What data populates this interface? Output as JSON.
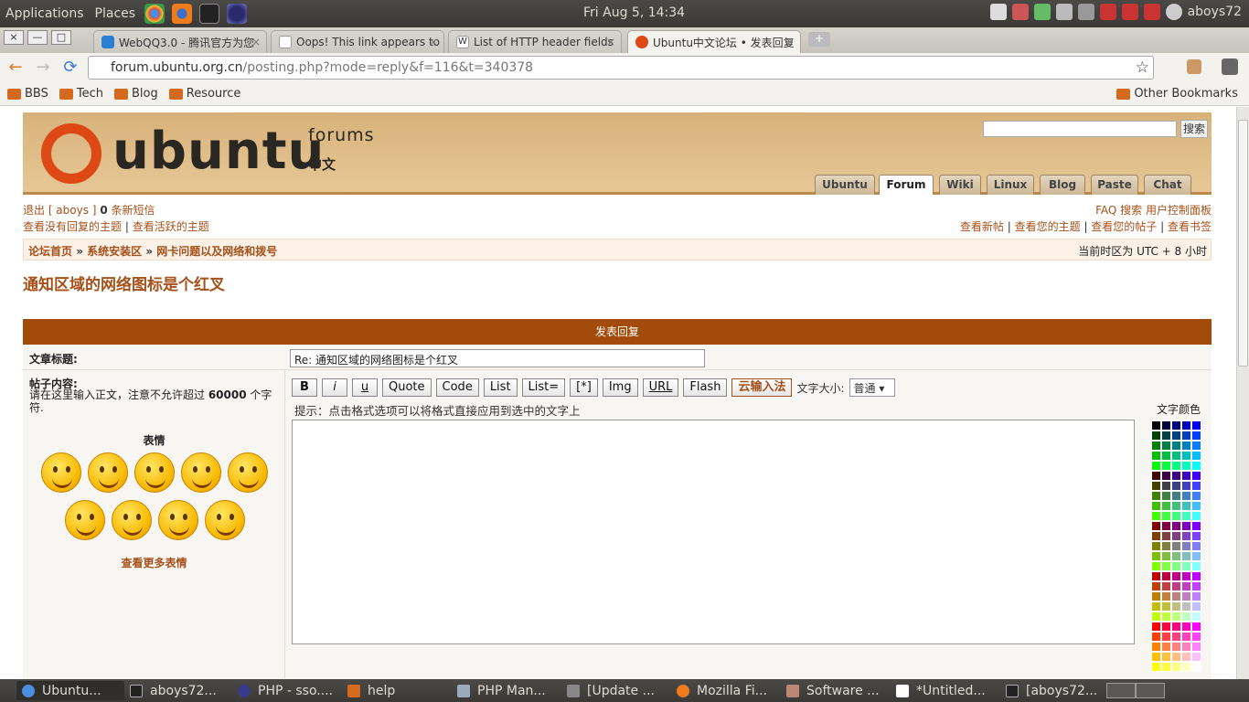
{
  "top_panel": {
    "applications": "Applications",
    "places": "Places",
    "clock": "Fri Aug  5, 14:34",
    "user": "aboys72"
  },
  "tabs": [
    {
      "label": "WebQQ3.0 - 腾讯官方为您",
      "color": "#2a7fd4"
    },
    {
      "label": "Oops! This link appears to",
      "color": "#ffffff"
    },
    {
      "label": "List of HTTP header fields",
      "color": "#ffffff"
    },
    {
      "label": "Ubuntu中文论坛 • 发表回复",
      "color": "#dd4814"
    }
  ],
  "window_buttons": {
    "close": "×",
    "min": "—",
    "max": "□"
  },
  "newtab": "+",
  "nav": {
    "back": "←",
    "forward": "→",
    "reload": "⟳",
    "star": "☆",
    "url_host": "forum.ubuntu.org.cn",
    "url_path": "/posting.php?mode=reply&f=116&t=340378"
  },
  "bookmarks": [
    "BBS",
    "Tech",
    "Blog",
    "Resource"
  ],
  "other_bookmarks": "Other Bookmarks",
  "site": {
    "logo_word": "ubuntu",
    "forums_word": "forums",
    "zh_word": "中文",
    "search_btn": "搜索"
  },
  "site_tabs": [
    "Ubuntu",
    "Forum",
    "Wiki",
    "Linux",
    "Blog",
    "Paste",
    "Chat"
  ],
  "userbar": {
    "logout": "退出 [ aboys ]",
    "pm_count": "0",
    "pm": "条新短信",
    "unanswered": "查看没有回复的主题",
    "active": "查看活跃的主题",
    "faq": "FAQ",
    "search": "搜索",
    "ucp": "用户控制面板",
    "new_posts": "查看新帖",
    "your_topics": "查看您的主题",
    "your_posts": "查看您的帖子",
    "bookmarks": "查看书签"
  },
  "breadcrumb": [
    "论坛首页",
    "系统安装区",
    "网卡问题以及网络和拨号"
  ],
  "breadcrumb_sep": " » ",
  "timezone": "当前时区为 UTC + 8 小时",
  "topic_title": "通知区域的网络图标是个红叉",
  "post_header": "发表回复",
  "form": {
    "subject_label": "文章标题:",
    "subject_value": "Re: 通知区域的网络图标是个红叉",
    "body_label": "帖子内容:",
    "body_desc_a": "请在这里输入正文，注意不允许超过 ",
    "body_desc_limit": "60000",
    "body_desc_b": " 个字符.",
    "smilies_title": "表情",
    "more_smilies": "查看更多表情",
    "hint": "提示：点击格式选项可以将格式直接应用到选中的文字上",
    "color_label": "文字颜色",
    "font_size_label": "文字大小:",
    "font_size_value": "普通"
  },
  "toolbar": [
    "B",
    "i",
    "u",
    "Quote",
    "Code",
    "List",
    "List=",
    "[*]",
    "Img",
    "URL",
    "Flash"
  ],
  "toolbar_cloud": "云输入法",
  "taskbar": [
    "Ubuntu...",
    "aboys72...",
    "PHP - sso....",
    "help",
    "PHP Man...",
    "[Update ...",
    "Mozilla Fi...",
    "Software ...",
    "*Untitled...",
    "[aboys72..."
  ]
}
